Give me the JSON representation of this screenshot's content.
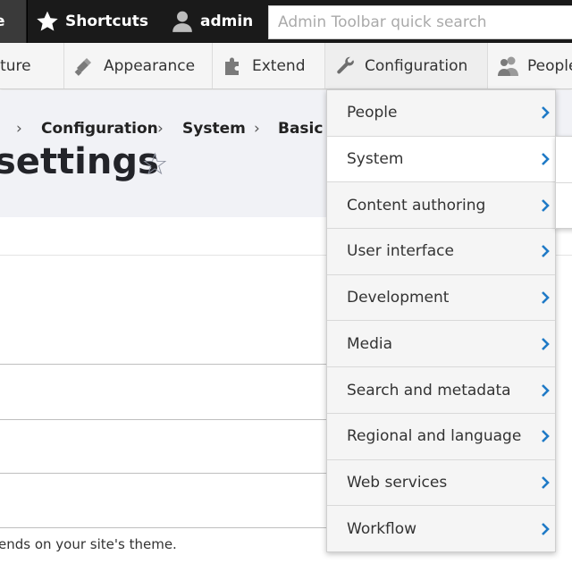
{
  "toolbar": {
    "home_label": "e",
    "shortcuts_label": "Shortcuts",
    "user_label": "admin",
    "search_placeholder": "Admin Toolbar quick search"
  },
  "tray": {
    "items": [
      {
        "label": "ucture",
        "icon": "structure-icon"
      },
      {
        "label": "Appearance",
        "icon": "paint-roller-icon"
      },
      {
        "label": "Extend",
        "icon": "puzzle-icon"
      },
      {
        "label": "Configuration",
        "icon": "wrench-icon"
      },
      {
        "label": "People",
        "icon": "people-icon"
      }
    ]
  },
  "breadcrumb": {
    "items": [
      "Configuration",
      "System",
      "Basic s"
    ],
    "separator": "›"
  },
  "page": {
    "title": "settings",
    "star": "☆",
    "description": "ends on your site's theme."
  },
  "configuration_menu": {
    "items": [
      {
        "label": "People"
      },
      {
        "label": "System",
        "active": true
      },
      {
        "label": "Content authoring"
      },
      {
        "label": "User interface"
      },
      {
        "label": "Development"
      },
      {
        "label": "Media"
      },
      {
        "label": "Search and metadata"
      },
      {
        "label": "Regional and language"
      },
      {
        "label": "Web services"
      },
      {
        "label": "Workflow"
      }
    ]
  },
  "colors": {
    "toolbar_bg": "#1a1a1a",
    "tray_bg": "#f5f5f5",
    "chevron": "#1f7ac6",
    "header_bg": "#f1f2f6"
  }
}
